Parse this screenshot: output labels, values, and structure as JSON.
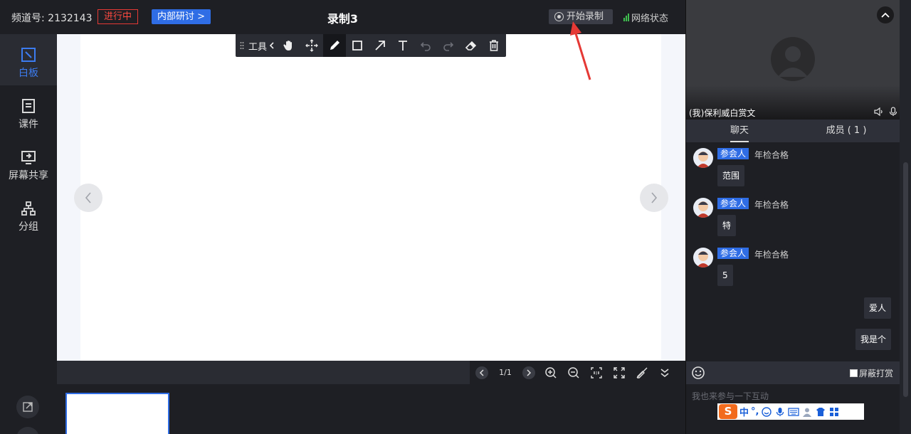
{
  "header": {
    "channel": "频道号: 2132143",
    "status": "进行中",
    "meeting_type": "内部研讨",
    "meeting_type_chevron": ">",
    "title": "录制3",
    "record_label": "开始录制",
    "network_label": "网络状态"
  },
  "sidebar": {
    "items": [
      {
        "label": "白板",
        "icon": "whiteboard-icon",
        "active": true
      },
      {
        "label": "课件",
        "icon": "courseware-icon"
      },
      {
        "label": "屏幕共享",
        "icon": "screen-share-icon"
      },
      {
        "label": "分组",
        "icon": "group-icon"
      }
    ]
  },
  "toolbar": {
    "label": "工具",
    "tools": [
      "hand-icon",
      "move-icon",
      "pen-icon",
      "rectangle-icon",
      "arrow-icon",
      "text-icon",
      "undo-icon",
      "redo-icon",
      "eraser-icon",
      "trash-icon"
    ]
  },
  "pagebar": {
    "page": "1/1"
  },
  "video": {
    "self_name": "(我)保利威白赏文"
  },
  "tabs": {
    "chat": "聊天",
    "members": "成员 ( 1 )"
  },
  "chat": {
    "messages": [
      {
        "role": "参会人",
        "sender": "年检合格",
        "text": "范围"
      },
      {
        "role": "参会人",
        "sender": "年检合格",
        "text": "特"
      },
      {
        "role": "参会人",
        "sender": "年检合格",
        "text": "5"
      }
    ],
    "mine": [
      "爱人",
      "我是个"
    ]
  },
  "chat_tools": {
    "mute_reward": "屏蔽打赏"
  },
  "chat_input": {
    "placeholder": "我也来参与一下互动"
  },
  "ime": {
    "logo": "S",
    "mode": "中",
    "punct": "°,"
  },
  "colors": {
    "accent": "#2f6de5",
    "live_red": "#e53935",
    "active_blue": "#3c7cf0",
    "signal_green": "#3fbf4f"
  }
}
